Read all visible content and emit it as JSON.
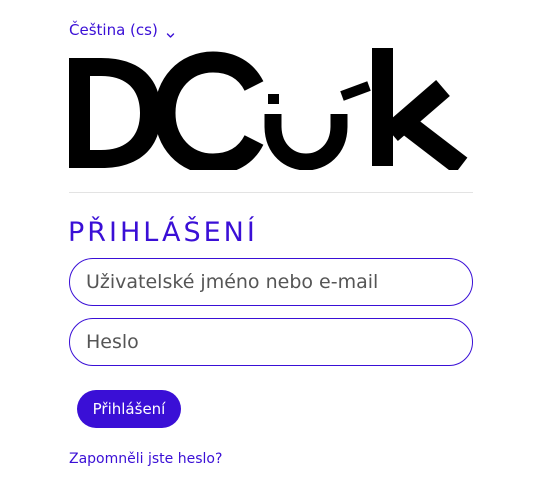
{
  "colors": {
    "accent": "#3a0fd6",
    "logo": "#000000"
  },
  "language": {
    "selected": "Čeština (cs)",
    "icon": "chevron-down-icon"
  },
  "logo": {
    "letters": [
      "D",
      "C",
      "k"
    ],
    "icon": "smiley-face-logo"
  },
  "login": {
    "title": "PŘIHLÁŠENÍ",
    "username_placeholder": "Uživatelské jméno nebo e-mail",
    "password_placeholder": "Heslo",
    "submit_label": "Přihlášení",
    "forgot_link": "Zapomněli jste heslo?"
  }
}
